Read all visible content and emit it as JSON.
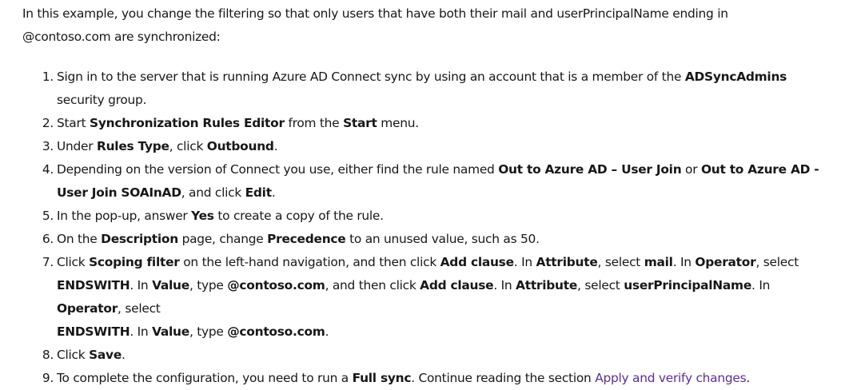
{
  "intro": {
    "line1": "In this example, you change the filtering so that only users that have both their mail and userPrincipalName ending in",
    "line2": "@contoso.com are synchronized:"
  },
  "steps": [
    {
      "num": "1.",
      "t1": "Sign in to the server that is running Azure AD Connect sync by using an account that is a member of the ",
      "b1": "ADSyncAdmins",
      "t2": " security group."
    },
    {
      "num": "2.",
      "t1": "Start ",
      "b1": "Synchronization Rules Editor",
      "t2": " from the ",
      "b2": "Start",
      "t3": " menu."
    },
    {
      "num": "3.",
      "t1": "Under ",
      "b1": "Rules Type",
      "t2": ", click ",
      "b2": "Outbound",
      "t3": "."
    },
    {
      "num": "4.",
      "t1": "Depending on the version of Connect you use, either find the rule named ",
      "b1": "Out to Azure AD – User Join",
      "t2": " or ",
      "b2": "Out to Azure AD - User Join SOAInAD",
      "t3": ", and click ",
      "b3": "Edit",
      "t4": "."
    },
    {
      "num": "5.",
      "t1": "In the pop-up, answer ",
      "b1": "Yes",
      "t2": " to create a copy of the rule."
    },
    {
      "num": "6.",
      "t1": "On the ",
      "b1": "Description",
      "t2": " page, change ",
      "b2": "Precedence",
      "t3": " to an unused value, such as 50."
    },
    {
      "num": "7.",
      "t1": "Click ",
      "b1": "Scoping filter",
      "t2": " on the left-hand navigation, and then click ",
      "b2": "Add clause",
      "t3": ". In ",
      "b3": "Attribute",
      "t4": ", select ",
      "b4": "mail",
      "t5": ". In ",
      "b5": "Operator",
      "t6": ", select ",
      "b6": "ENDSWITH",
      "t7": ". In ",
      "b7": "Value",
      "t8": ", type ",
      "b8": "@contoso.com",
      "t9": ", and then click ",
      "b9": "Add clause",
      "t10": ". In ",
      "b10": "Attribute",
      "t11": ", select ",
      "b11": "userPrincipalName",
      "t12": ". In ",
      "b12": "Operator",
      "t13": ", select ",
      "b13": "ENDSWITH",
      "t14": ". In ",
      "b14": "Value",
      "t15": ", type ",
      "b15": "@contoso.com",
      "t16": "."
    },
    {
      "num": "8.",
      "t1": "Click ",
      "b1": "Save",
      "t2": "."
    },
    {
      "num": "9.",
      "t1": "To complete the configuration, you need to run a ",
      "b1": "Full sync",
      "t2": ". Continue reading the section ",
      "link": "Apply and verify changes",
      "t3": "."
    }
  ],
  "colors": {
    "text": "#171717",
    "link": "#5c2e91"
  }
}
